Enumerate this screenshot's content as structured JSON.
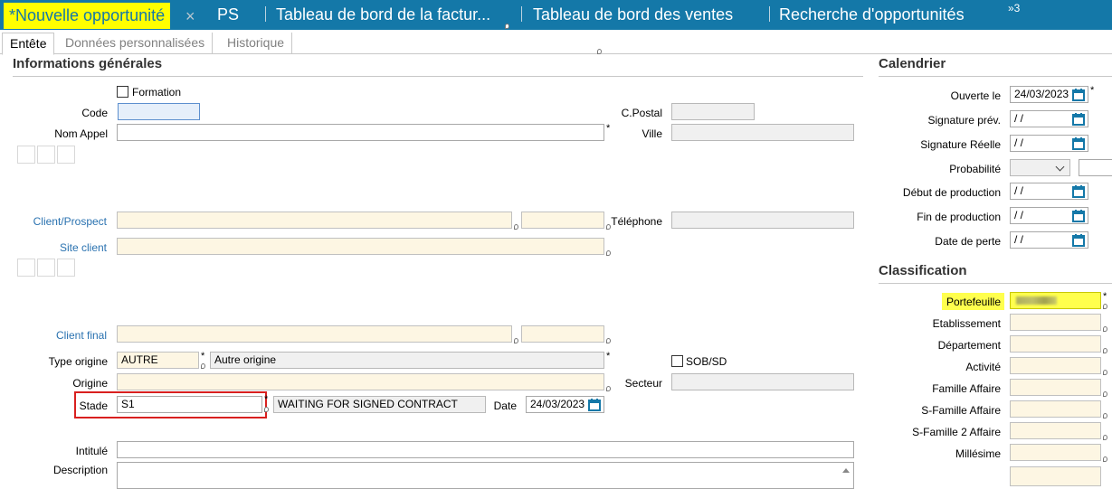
{
  "topTabs": [
    {
      "label": "*Nouvelle opportunité",
      "close": "×"
    },
    {
      "label": "PS"
    },
    {
      "label": "Tableau de bord de la factur..."
    },
    {
      "label": "Tableau de bord des ventes"
    },
    {
      "label": "Recherche d'opportunités"
    }
  ],
  "overflow": "»3",
  "subTabs": [
    "Entête",
    "Données personnalisées",
    "Historique"
  ],
  "general": {
    "title": "Informations générales",
    "formation": "Formation",
    "code": {
      "label": "Code",
      "value": ""
    },
    "nomAppel": {
      "label": "Nom Appel",
      "value": ""
    },
    "cpostal": {
      "label": "C.Postal",
      "value": ""
    },
    "ville": {
      "label": "Ville",
      "value": ""
    },
    "client": {
      "label": "Client/Prospect",
      "value": "",
      "code": ""
    },
    "telephone": {
      "label": "Téléphone",
      "value": ""
    },
    "site": {
      "label": "Site client",
      "value": ""
    },
    "clientFinal": {
      "label": "Client final",
      "value": "",
      "code": ""
    },
    "typeOrigine": {
      "label": "Type origine",
      "code": "AUTRE",
      "value": "Autre origine"
    },
    "sobsd": "SOB/SD",
    "origine": {
      "label": "Origine",
      "value": ""
    },
    "secteur": {
      "label": "Secteur",
      "value": ""
    },
    "stade": {
      "label": "Stade",
      "code": "S1",
      "value": "WAITING FOR SIGNED CONTRACT"
    },
    "date": {
      "label": "Date",
      "value": "24/03/2023"
    },
    "intitule": {
      "label": "Intitulé",
      "value": ""
    },
    "description": {
      "label": "Description",
      "value": ""
    }
  },
  "calendar": {
    "title": "Calendrier",
    "ouverte": {
      "label": "Ouverte le",
      "value": "24/03/2023"
    },
    "signaturePrev": {
      "label": "Signature prév.",
      "value": " /  /"
    },
    "signatureReelle": {
      "label": "Signature Réelle",
      "value": " /  /"
    },
    "probabilite": {
      "label": "Probabilité",
      "value": ""
    },
    "debutProd": {
      "label": "Début de production",
      "value": " /  /"
    },
    "finProd": {
      "label": "Fin de production",
      "value": " /  /"
    },
    "datePerte": {
      "label": "Date de perte",
      "value": " /  /"
    }
  },
  "classification": {
    "title": "Classification",
    "fields": [
      {
        "label": "Portefeuille"
      },
      {
        "label": "Etablissement"
      },
      {
        "label": "Département"
      },
      {
        "label": "Activité"
      },
      {
        "label": "Famille Affaire"
      },
      {
        "label": "S-Famille Affaire"
      },
      {
        "label": "S-Famille 2 Affaire"
      },
      {
        "label": "Millésime"
      }
    ]
  },
  "colors": {
    "tabbar": "#1478a8",
    "highlight": "#ffff00",
    "required_box": "#d9201f",
    "link": "#2a72b0"
  }
}
